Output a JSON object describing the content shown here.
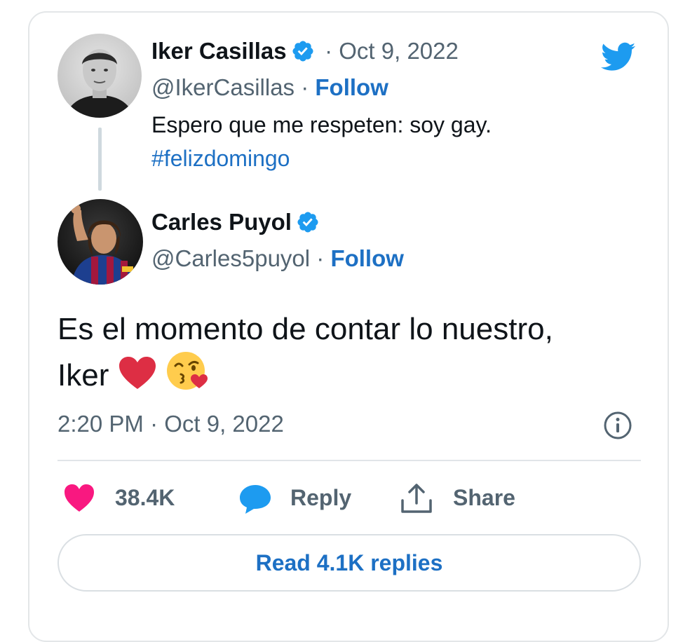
{
  "quoted_tweet": {
    "author_name": "Iker Casillas",
    "date": "· Oct 9, 2022",
    "handle": "@IkerCasillas",
    "separator": "·",
    "follow_label": "Follow",
    "text": "Espero que me respeten: soy gay.",
    "hashtag": "#felizdomingo"
  },
  "reply_tweet": {
    "author_name": "Carles Puyol",
    "handle": "@Carles5puyol",
    "separator": "·",
    "follow_label": "Follow",
    "text_line1": "Es el momento de contar lo nuestro,",
    "text_line2": "Iker",
    "emojis": [
      "red-heart",
      "face-blowing-a-kiss"
    ],
    "timestamp": "2:20 PM · Oct 9, 2022"
  },
  "actions": {
    "likes_count": "38.4K",
    "reply_label": "Reply",
    "share_label": "Share"
  },
  "read_replies_label": "Read 4.1K replies",
  "icons": {
    "brand": "twitter-bird-icon",
    "verified": "verified-badge-icon",
    "info": "info-icon",
    "like": "heart-icon",
    "reply": "speech-bubble-icon",
    "share": "share-icon"
  },
  "colors": {
    "twitter_blue": "#1d9bf0",
    "link_blue": "#1d70c4",
    "like_pink": "#f91880",
    "muted_text": "#536471",
    "text": "#0f1419",
    "border": "#e3e6e8"
  }
}
